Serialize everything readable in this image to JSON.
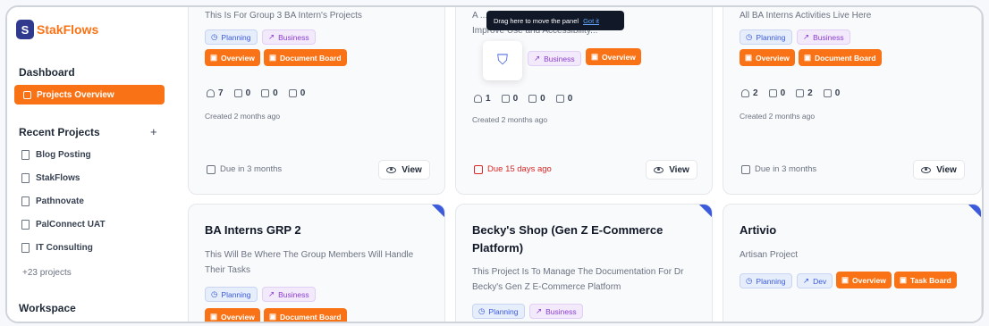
{
  "brand": {
    "logo_letter": "S",
    "name": "StakFlows"
  },
  "sidebar": {
    "dashboard_heading": "Dashboard",
    "active_item": "Projects Overview",
    "recent_heading": "Recent Projects",
    "add_symbol": "+",
    "projects": [
      "Blog Posting",
      "StakFlows",
      "Pathnovate",
      "PalConnect UAT",
      "IT Consulting"
    ],
    "more": "+23 projects",
    "workspace_heading": "Workspace"
  },
  "tooltip": {
    "text": "Drag here to move the panel",
    "link": "Got it"
  },
  "cards": [
    {
      "desc": "This Is For Group 3 BA Intern's Projects",
      "tags": [
        "Planning",
        "Business"
      ],
      "actions": [
        "Overview",
        "Document Board"
      ],
      "stats": [
        "7",
        "0",
        "0",
        "0"
      ],
      "created": "Created 2 months ago",
      "due": "Due in 3 months",
      "view": "View"
    },
    {
      "desc_line1": "A ... Website To",
      "desc_line2": "Improve Use and Accessibility...",
      "tags": [
        "Business"
      ],
      "actions": [
        "Overview"
      ],
      "stats": [
        "1",
        "0",
        "0",
        "0"
      ],
      "created": "Created 2 months ago",
      "due": "Due 15 days ago",
      "view": "View"
    },
    {
      "desc": "All BA Interns Activities Live Here",
      "tags": [
        "Planning",
        "Business"
      ],
      "actions": [
        "Overview",
        "Document Board"
      ],
      "stats": [
        "2",
        "0",
        "2",
        "0"
      ],
      "created": "Created 2 months ago",
      "due": "Due in 3 months",
      "view": "View"
    },
    {
      "title": "BA Interns GRP 2",
      "desc_line1": "This Will Be Where The Group Members Will Handle",
      "desc_line2": "Their Tasks",
      "tags": [
        "Planning",
        "Business"
      ],
      "actions": [
        "Overview",
        "Document Board"
      ]
    },
    {
      "title_line1": "Becky's Shop (Gen Z E-Commerce",
      "title_line2": "Platform)",
      "desc_line1": "This Project Is To Manage The Documentation For Dr",
      "desc_line2": "Becky's Gen Z E-Commerce Platform",
      "tags": [
        "Planning",
        "Business"
      ]
    },
    {
      "title": "Artivio",
      "desc": "Artisan Project",
      "tags": [
        "Planning",
        "Dev"
      ],
      "actions": [
        "Overview",
        "Task Board"
      ]
    }
  ]
}
